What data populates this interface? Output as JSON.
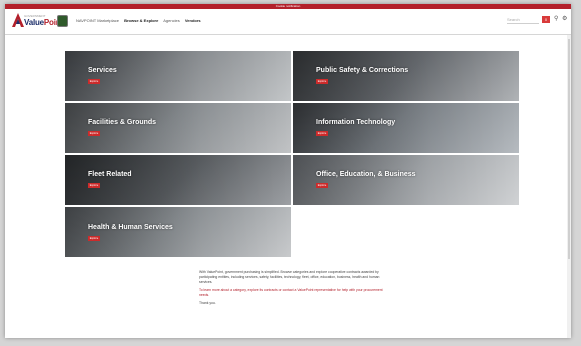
{
  "topbar": {
    "text": "Cookie notification"
  },
  "header": {
    "logo_small": "GOVERNMENT",
    "logo_main_a": "Value",
    "logo_main_b": "Point",
    "nav_items": [
      "NAVPOINT Marketplace",
      "Browse & Explore",
      "Agencies",
      "Vendors"
    ],
    "search_placeholder": "Search",
    "cart_count": "0"
  },
  "tiles": [
    {
      "title": "Services",
      "button": "Explore",
      "accent": "#b3202b"
    },
    {
      "title": "Public Safety & Corrections",
      "button": "Explore",
      "accent": "#b3202b"
    },
    {
      "title": "Facilities & Grounds",
      "button": "Explore",
      "accent": "#b3202b"
    },
    {
      "title": "Information Technology",
      "button": "Explore",
      "accent": "#b3202b"
    },
    {
      "title": "Fleet Related",
      "button": "Explore",
      "accent": "#b3202b"
    },
    {
      "title": "Office, Education, & Business",
      "button": "Explore",
      "accent": "#b3202b"
    },
    {
      "title": "Health & Human Services",
      "button": "Explore",
      "accent": "#b3202b"
    }
  ],
  "intro": {
    "p1": "With ValuePoint, government purchasing is simplified. Browse categories and explore cooperative contracts awarded by participating entities, including services, safety, facilities, technology, fleet, office, education, business, health and human services.",
    "p2": "To learn more about a category, explore its contracts or contact a ValuePoint representative for help with your procurement needs.",
    "p3": "Thank you."
  }
}
